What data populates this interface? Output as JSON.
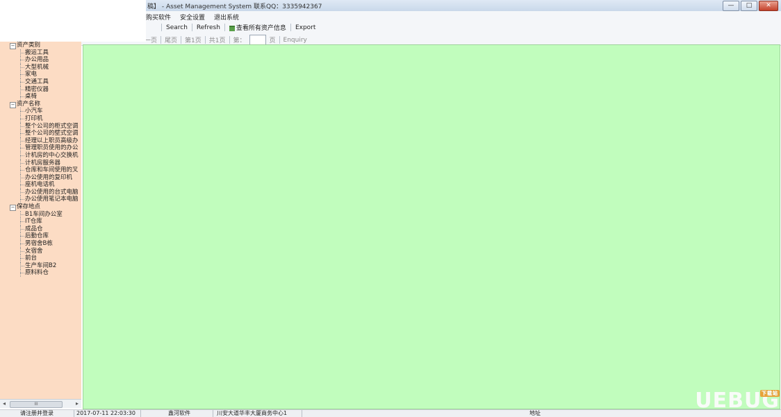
{
  "window": {
    "title": "稿】 - Asset Management System  联系QQ：3335942367",
    "controls": [
      "—",
      "□",
      "✕"
    ]
  },
  "menu": {
    "items": [
      "购买软件",
      "安全设置",
      "退出系统"
    ]
  },
  "toolbar": {
    "search": "Search",
    "refresh": "Refresh",
    "view_all": "查看所有资产信息",
    "export": "Export"
  },
  "pager": {
    "prev": "一页",
    "last": "尾页",
    "current_page": "第1页",
    "total_pages": "共1页",
    "goto_prefix": "第：",
    "goto_value": "",
    "goto_suffix": "页",
    "enquiry": "Enquiry"
  },
  "tree": {
    "groups": [
      {
        "label": "资产类别",
        "items": [
          "搬运工具",
          "办公用品",
          "大型机械",
          "家电",
          "交通工具",
          "精密仪器",
          "桌椅"
        ]
      },
      {
        "label": "资产名称",
        "items": [
          "小汽车",
          "打印机",
          "整个公司的柜式空调",
          "整个公司的壁式空调",
          "经理以上职员高级办",
          "管理职员使用的办公",
          "计机房的中心交换机",
          "计机房服务器",
          "仓库和车间使用的叉",
          "办公使用的复印机",
          "座机电话机",
          "办公使用的台式电脑",
          "办公使用笔记本电脑"
        ]
      },
      {
        "label": "保存地点",
        "items": [
          "B1车间办公室",
          "IT仓库",
          "成品仓",
          "后勤仓库",
          "男宿舍B栋",
          "女宿舍",
          "前台",
          "生产车间B2",
          "原料料仓"
        ]
      }
    ]
  },
  "scrollbar": {
    "left": "◂",
    "thumb": "III",
    "right": "▸"
  },
  "status": {
    "login": "请注册并登录",
    "datetime": "2017-07-11 22:03:30",
    "company": "鑫河软件",
    "address_value": "川安大道华丰大厦商务中心1",
    "address_label": "地址"
  },
  "watermark": {
    "text": "UEBUG",
    "badge": "下载站"
  },
  "colors": {
    "sidebar_bg": "#fcdcc4",
    "main_bg": "#c1fdbd",
    "titlebar": "#c9d8ea"
  }
}
